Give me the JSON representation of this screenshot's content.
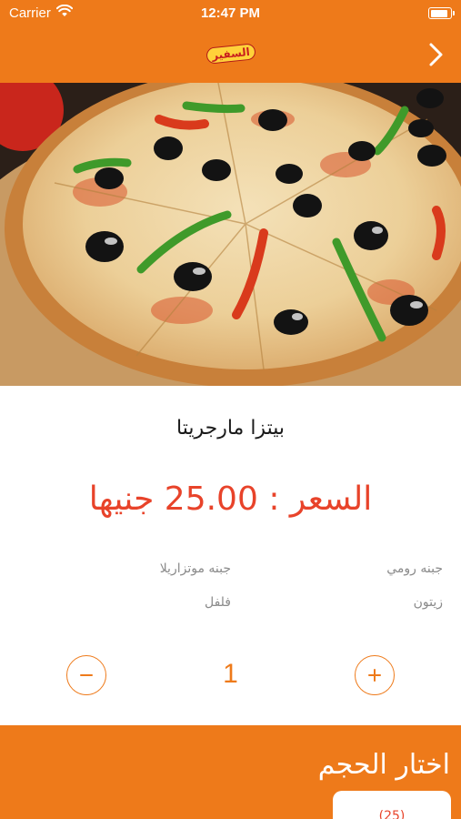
{
  "status_bar": {
    "carrier": "Carrier",
    "time": "12:47 PM"
  },
  "nav": {
    "logo_text": "السفير"
  },
  "product": {
    "title": "بيتزا مارجريتا",
    "price_label": "السعر :",
    "price_value": "25.00",
    "currency": "جنيها",
    "ingredients": [
      "جبنه رومي",
      "جبنه موتزاريلا",
      "زيتون",
      "فلفل"
    ]
  },
  "quantity": {
    "value": "1",
    "minus_symbol": "−",
    "plus_symbol": "+"
  },
  "size_section": {
    "heading": "اختار الحجم",
    "first_option_partial": "(25)"
  },
  "colors": {
    "brand_orange": "#ee7a1a",
    "price_red": "#e8432a",
    "muted_text": "#8a8a8a"
  },
  "icons": {
    "wifi": "wifi-icon",
    "battery": "battery-icon",
    "back": "chevron-right-icon",
    "minus": "minus-icon",
    "plus": "plus-icon"
  }
}
